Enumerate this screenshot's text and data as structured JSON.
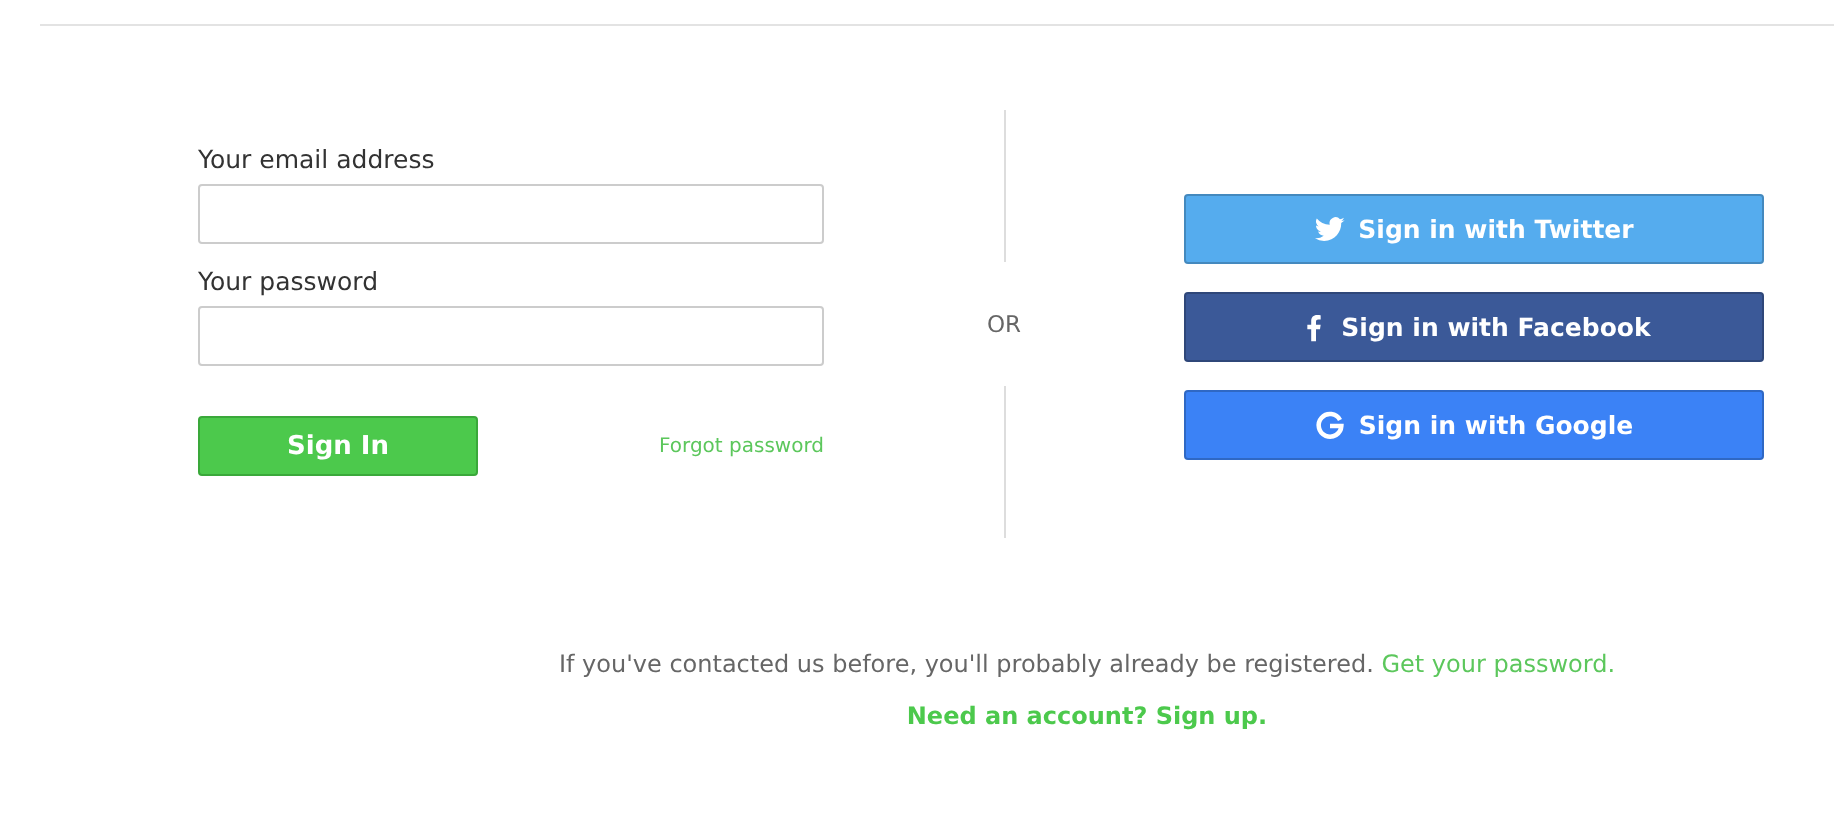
{
  "form": {
    "fields": [
      {
        "label": "Your email address"
      },
      {
        "label": "Your password"
      }
    ],
    "submit": "Sign In",
    "forgot": "Forgot password"
  },
  "divider": "OR",
  "social": [
    {
      "label": "Sign in with Twitter",
      "kind": "twitter",
      "color": "#55acee"
    },
    {
      "label": "Sign in with Facebook",
      "kind": "facebook",
      "color": "#3b5998"
    },
    {
      "label": "Sign in with Google",
      "kind": "google",
      "color": "#3b82f6"
    }
  ],
  "footer": {
    "text": "If you've contacted us before, you'll probably already be registered.",
    "link": "Get your password.",
    "signup": "Need an account? Sign up."
  }
}
